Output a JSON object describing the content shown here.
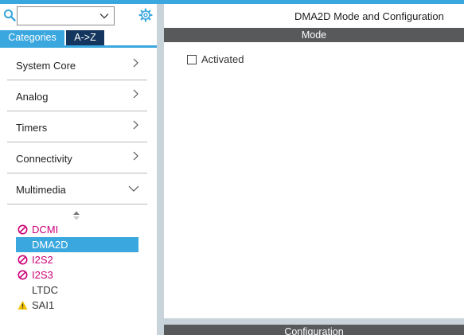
{
  "search": {
    "value": ""
  },
  "tabs": [
    {
      "label": "Categories"
    },
    {
      "label": "A->Z"
    }
  ],
  "categories": [
    {
      "label": "System Core",
      "state": "collapsed"
    },
    {
      "label": "Analog",
      "state": "collapsed"
    },
    {
      "label": "Timers",
      "state": "collapsed"
    },
    {
      "label": "Connectivity",
      "state": "collapsed"
    },
    {
      "label": "Multimedia",
      "state": "expanded"
    }
  ],
  "peripherals": [
    {
      "label": "DCMI",
      "status": "error"
    },
    {
      "label": "DMA2D",
      "status": "selected"
    },
    {
      "label": "I2S2",
      "status": "error"
    },
    {
      "label": "I2S3",
      "status": "error"
    },
    {
      "label": "LTDC",
      "status": "none"
    },
    {
      "label": "SAI1",
      "status": "warning"
    }
  ],
  "main": {
    "title": "DMA2D Mode and Configuration",
    "mode_header": "Mode",
    "activated_label": "Activated",
    "activated_checked": false,
    "config_header": "Configuration"
  },
  "colors": {
    "accent": "#3aa7de",
    "tab_dark": "#14365e",
    "header_gray": "#58595b",
    "error": "#cc0077",
    "warning": "#f2c200"
  }
}
